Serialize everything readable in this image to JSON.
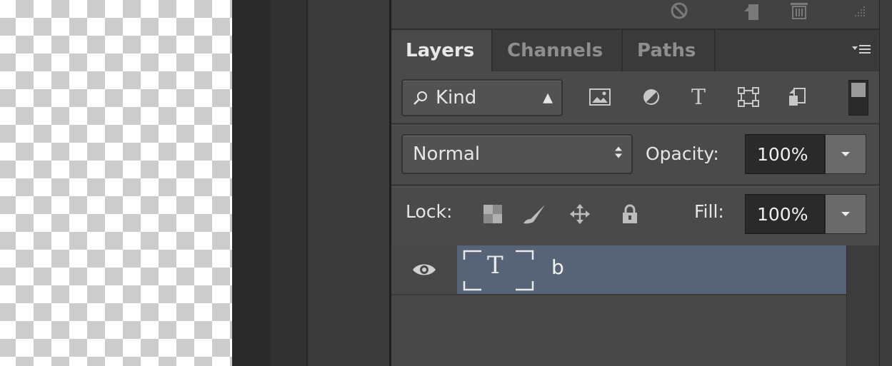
{
  "tabs": [
    {
      "label": "Layers",
      "active": true
    },
    {
      "label": "Channels",
      "active": false
    },
    {
      "label": "Paths",
      "active": false
    }
  ],
  "panel_menu_icon": "panel-menu-icon",
  "filter": {
    "kind_label": "Kind",
    "icons": [
      "pixel-layer-filter-icon",
      "adjustment-layer-filter-icon",
      "type-layer-filter-icon",
      "shape-layer-filter-icon",
      "smart-object-filter-icon"
    ],
    "type_glyph": "T"
  },
  "blend": {
    "mode": "Normal",
    "opacity_label": "Opacity:",
    "opacity_value": "100%"
  },
  "lock": {
    "label": "Lock:",
    "fill_label": "Fill:",
    "fill_value": "100%"
  },
  "layers": [
    {
      "name": "b",
      "type_glyph": "T",
      "visible": true,
      "selected": true
    }
  ],
  "colors": {
    "panel_bg": "#4a4a4a",
    "selected_layer": "#576478",
    "tab_inactive": "#8e8e8e"
  }
}
